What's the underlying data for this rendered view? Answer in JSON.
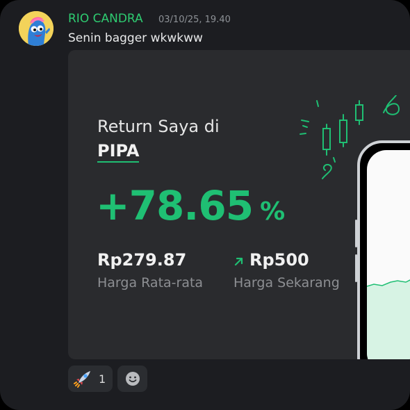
{
  "message": {
    "username": "RIO CANDRA",
    "timestamp": "03/10/25, 19.40",
    "text": "Senin bagger wkwkww",
    "username_color": "#2ecc71"
  },
  "embed": {
    "title_line": "Return Saya di",
    "ticker": "PIPA",
    "return_value": "+78.65",
    "return_unit": "%",
    "avg_price": "Rp279.87",
    "avg_price_label": "Harga Rata-rata",
    "current_price": "Rp500",
    "current_price_label": "Harga Sekarang",
    "accent_color": "#1fbf73"
  },
  "reactions": [
    {
      "icon": "rocket-icon",
      "count": "1"
    },
    {
      "icon": "add-reaction-smiley-icon"
    }
  ]
}
